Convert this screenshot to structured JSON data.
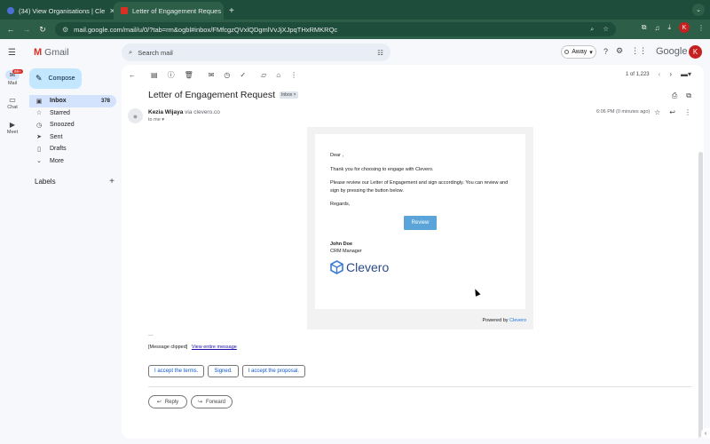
{
  "browser": {
    "tabs": [
      {
        "label": "(34) View Organisations | Cle",
        "active": false
      },
      {
        "label": "Letter of Engagement Reques",
        "active": true
      }
    ],
    "new_tab": "+",
    "url": "mail.google.com/mail/u/0/?tab=rm&ogbl#inbox/FMfcgzQVxlQDgmlVvJjXJpqTHxRMKRQc",
    "profile_initial": "K"
  },
  "gmail": {
    "brand": "Gmail",
    "search_placeholder": "Search mail",
    "status": "Away",
    "google_wordmark": "Google",
    "avatar_initial": "K"
  },
  "rail": [
    {
      "label": "Mail",
      "badge": "99+"
    },
    {
      "label": "Chat"
    },
    {
      "label": "Meet"
    }
  ],
  "sidebar": {
    "compose": "Compose",
    "items": [
      {
        "label": "Inbox",
        "count": "378"
      },
      {
        "label": "Starred"
      },
      {
        "label": "Snoozed"
      },
      {
        "label": "Sent"
      },
      {
        "label": "Drafts"
      },
      {
        "label": "More"
      }
    ],
    "labels_heading": "Labels"
  },
  "toolbar": {
    "pagination": "1 of 1,223"
  },
  "email": {
    "subject": "Letter of Engagement Request",
    "label_chip": "Inbox ×",
    "sender_name": "Kezia Wijaya",
    "sender_via": "via clevero.co",
    "to": "to me ▾",
    "time": "6:06 PM (0 minutes ago)",
    "body": {
      "greeting": "Dear ,",
      "line1": "Thank you for choosing to engage with Clevero.",
      "line2": "Please review our Letter of Engagement and sign accordingly.  You can review and sign by pressing the button below.",
      "closing": "Regards,",
      "review_button": "Review",
      "signature_name": "John Doe",
      "signature_title": "CRM Manager",
      "logo_text": "Clevero"
    },
    "powered_by": "Powered by",
    "powered_link": "Clevero",
    "ellipsis": "...",
    "clipped": "[Message clipped]",
    "view_entire": "View entire message",
    "smart_replies": [
      "I accept the terms.",
      "Signed.",
      "I accept the proposal."
    ],
    "reply": "Reply",
    "forward": "Forward"
  },
  "colors": {
    "chrome_dark": "#1e4d3b",
    "chrome_mid": "#2d5e48",
    "compose": "#c2e7ff",
    "active_nav": "#d3e3fd",
    "review_button": "#5aa4d9",
    "link": "#1a73e8"
  }
}
